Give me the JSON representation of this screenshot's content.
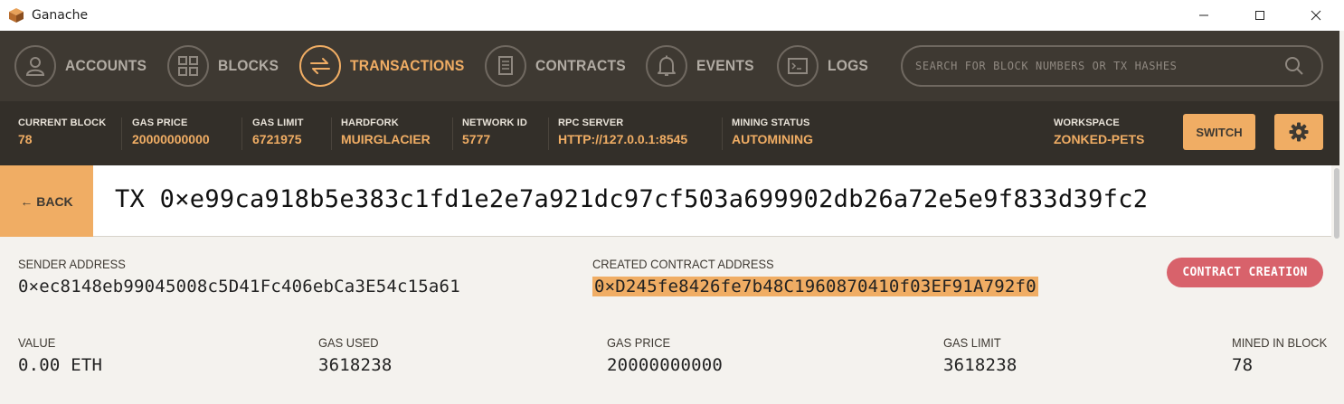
{
  "window": {
    "title": "Ganache",
    "controls": [
      "minimize",
      "maximize",
      "close"
    ]
  },
  "nav": {
    "items": [
      {
        "label": "ACCOUNTS",
        "icon": "person-icon",
        "active": false
      },
      {
        "label": "BLOCKS",
        "icon": "grid-icon",
        "active": false
      },
      {
        "label": "TRANSACTIONS",
        "icon": "swap-arrows-icon",
        "active": true
      },
      {
        "label": "CONTRACTS",
        "icon": "document-icon",
        "active": false
      },
      {
        "label": "EVENTS",
        "icon": "bell-icon",
        "active": false
      },
      {
        "label": "LOGS",
        "icon": "terminal-icon",
        "active": false
      }
    ],
    "search_placeholder": "SEARCH FOR BLOCK NUMBERS OR TX HASHES"
  },
  "status": {
    "current_block": {
      "label": "CURRENT BLOCK",
      "value": "78"
    },
    "gas_price": {
      "label": "GAS PRICE",
      "value": "20000000000"
    },
    "gas_limit": {
      "label": "GAS LIMIT",
      "value": "6721975"
    },
    "hardfork": {
      "label": "HARDFORK",
      "value": "MUIRGLACIER"
    },
    "network_id": {
      "label": "NETWORK ID",
      "value": "5777"
    },
    "rpc_server": {
      "label": "RPC SERVER",
      "value": "HTTP://127.0.0.1:8545"
    },
    "mining_status": {
      "label": "MINING STATUS",
      "value": "AUTOMINING"
    },
    "workspace": {
      "label": "WORKSPACE",
      "value": "ZONKED-PETS"
    },
    "switch_label": "SWITCH"
  },
  "tx": {
    "back_label": "← BACK",
    "title": "TX 0×e99ca918b5e383c1fd1e2e7a921dc97cf503a699902db26a72e5e9f833d39fc2",
    "sender_label": "SENDER ADDRESS",
    "sender_value": "0×ec8148eb99045008c5D41Fc406ebCa3E54c15a61",
    "created_label": "CREATED CONTRACT ADDRESS",
    "created_value": "0×D245fe8426fe7b48C1960870410f03EF91A792f0",
    "badge": "CONTRACT CREATION",
    "value_label": "VALUE",
    "value_value": "0.00 ETH",
    "gas_used_label": "GAS USED",
    "gas_used_value": "3618238",
    "gas_price_label": "GAS PRICE",
    "gas_price_value": "20000000000",
    "gas_limit_label": "GAS LIMIT",
    "gas_limit_value": "3618238",
    "mined_label": "MINED IN BLOCK",
    "mined_value": "78"
  },
  "colors": {
    "accent": "#f0ad64",
    "nav_bg": "#3e3932",
    "status_bg": "#332f29",
    "badge": "#d8626b",
    "content_bg": "#f4f2ee"
  }
}
